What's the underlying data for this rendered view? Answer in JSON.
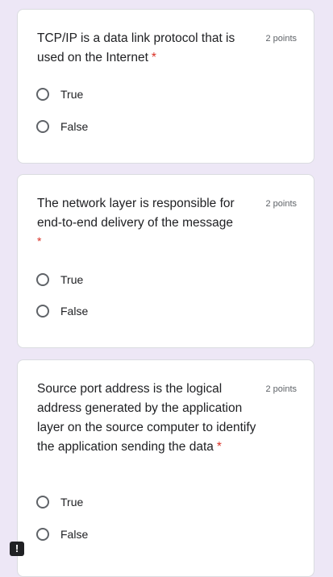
{
  "questions": [
    {
      "text": "TCP/IP is a data link protocol that is used on the Internet",
      "required_mark": "*",
      "points": "2 points",
      "options": [
        "True",
        "False"
      ]
    },
    {
      "text": "The network layer is responsible for end-to-end delivery of the message",
      "required_mark": "*",
      "points": "2 points",
      "options": [
        "True",
        "False"
      ]
    },
    {
      "text": "Source port address is the logical address generated by the application layer on the source computer to identify the application sending the data",
      "required_mark": "*",
      "points": "2 points",
      "options": [
        "True",
        "False"
      ]
    }
  ],
  "feedback_icon": {
    "glyph": "!",
    "icon": "report-problem-icon"
  },
  "colors": {
    "background": "#ede7f6",
    "required": "#d93025",
    "text": "#202124",
    "secondary_text": "#5f6368"
  }
}
